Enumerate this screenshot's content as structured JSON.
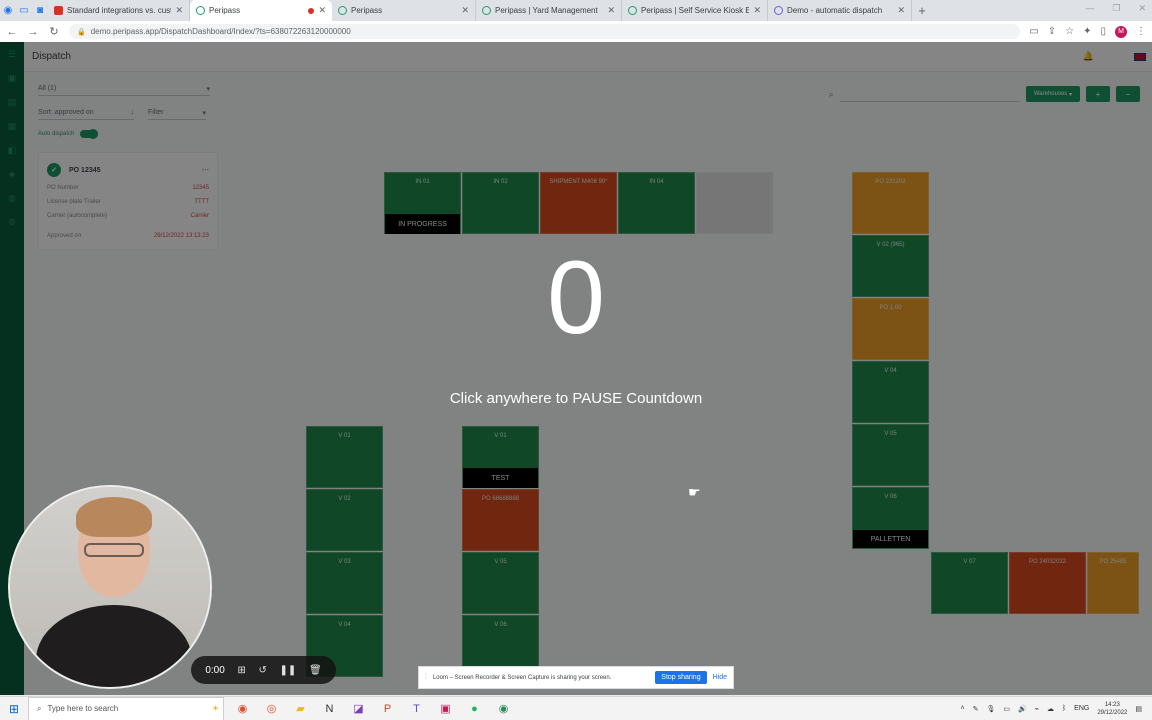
{
  "browser": {
    "tabs": [
      {
        "label": "Standard integrations vs. custom",
        "favicon": "x-logo-icon"
      },
      {
        "label": "Peripass",
        "favicon": "peripass-icon",
        "active": true
      },
      {
        "label": "Peripass",
        "favicon": "peripass-icon"
      },
      {
        "label": "Peripass | Yard Management",
        "favicon": "peripass-icon"
      },
      {
        "label": "Peripass | Self Service Kiosk Engi",
        "favicon": "peripass-icon"
      },
      {
        "label": "Demo - automatic dispatch",
        "favicon": "loom-icon"
      }
    ],
    "url": "demo.peripass.app/DispatchDashboard/Index/?ts=638072263120000000",
    "profile_initial": "M"
  },
  "app": {
    "page_title": "Dispatch",
    "left_panel": {
      "filter_all": "All (1)",
      "sort_label": "Sort: approved on",
      "filter_label": "Filter",
      "auto_dispatch": "Auto dispatch",
      "card": {
        "title": "PO 12345",
        "rows": [
          {
            "key": "PO Number",
            "value": "12345"
          },
          {
            "key": "License plate Trailer",
            "value": "TTTT"
          },
          {
            "key": "Carrier (autocomplete)",
            "value": "Carrier"
          },
          {
            "key": "Approved on",
            "value": "29/12/2022 13:13:23"
          }
        ]
      }
    },
    "toolbar": {
      "warehouses_label": "Warehouses",
      "search_placeholder": ""
    },
    "docks": {
      "top_row": [
        {
          "label": "IN 01",
          "color": "green",
          "banner": "IN PROGRESS"
        },
        {
          "label": "IN 02",
          "color": "green"
        },
        {
          "label": "SHIPMENT M406 90°",
          "color": "red"
        },
        {
          "label": "IN 04",
          "color": "green"
        },
        {
          "label": "",
          "color": "grey"
        }
      ],
      "right_column": [
        {
          "label": "PO 231202",
          "color": "orange"
        },
        {
          "label": "V 02 (965)",
          "color": "green"
        },
        {
          "label": "PO 1.00",
          "color": "orange"
        },
        {
          "label": "V 04",
          "color": "green"
        },
        {
          "label": "V 05",
          "color": "green"
        },
        {
          "label": "V 06",
          "color": "green",
          "banner": "PALLETTEN"
        }
      ],
      "bottom_left_a": [
        {
          "label": "V 01",
          "color": "green"
        },
        {
          "label": "V 02",
          "color": "green"
        },
        {
          "label": "V 03",
          "color": "green"
        },
        {
          "label": "V 04",
          "color": "green"
        }
      ],
      "bottom_left_b": [
        {
          "label": "V 01",
          "color": "green",
          "banner": "TEST"
        },
        {
          "label": "PO 68688888",
          "color": "red"
        },
        {
          "label": "V 05",
          "color": "green"
        },
        {
          "label": "V 06",
          "color": "green"
        }
      ],
      "bottom_right": [
        {
          "label": "V 07",
          "color": "green"
        },
        {
          "label": "PO 24032022",
          "color": "red"
        },
        {
          "label": "PO 25485",
          "color": "orange"
        }
      ]
    }
  },
  "overlay": {
    "countdown": "0",
    "message": "Click anywhere to PAUSE Countdown",
    "timer": "0:00",
    "share_message": "Loom – Screen Recorder & Screen Capture is sharing your screen.",
    "stop_sharing": "Stop sharing",
    "hide": "Hide"
  },
  "taskbar": {
    "search_placeholder": "Type here to search",
    "language": "ENG",
    "time": "14:23",
    "date": "29/12/2022"
  },
  "colors": {
    "dock_green": "#1f8a4c",
    "dock_red": "#d9491f",
    "dock_orange": "#f0a02a",
    "brand_dark": "#0b5a3a"
  }
}
